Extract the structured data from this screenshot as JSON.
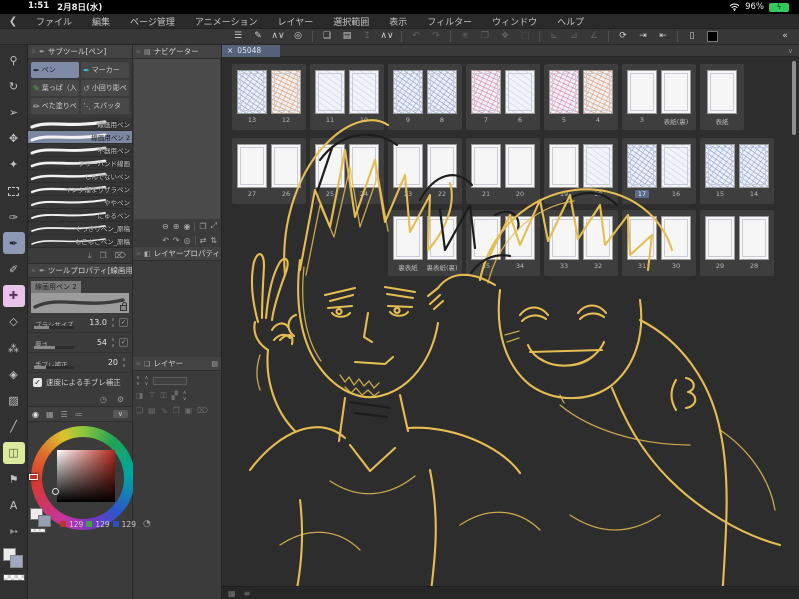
{
  "status_bar": {
    "time": "1:51",
    "date": "2月8日(水)",
    "battery_percent": "96%",
    "wifi_icon": "wifi-icon",
    "battery_icon": "battery-charging-icon",
    "bolt_glyph": "ϟ"
  },
  "menu_bar": {
    "logo_icon": "clip-studio-logo",
    "logo_glyph": "❮",
    "items": [
      "ファイル",
      "編集",
      "ページ管理",
      "アニメーション",
      "レイヤー",
      "選択範囲",
      "表示",
      "フィルター",
      "ウィンドウ",
      "ヘルプ"
    ]
  },
  "toolbar": {
    "items": [
      {
        "name": "main-menu-icon",
        "g": "☰",
        "on": true
      },
      {
        "name": "pen-settings-icon",
        "g": "✎",
        "on": true
      },
      {
        "name": "workspace-cycle-icon",
        "g": "∧∨",
        "on": true
      },
      {
        "name": "timelapse-record-icon",
        "g": "◎",
        "on": true
      },
      {
        "sep": true
      },
      {
        "name": "new-page-icon",
        "g": "❏",
        "on": true
      },
      {
        "name": "open-file-icon",
        "g": "▤",
        "on": true
      },
      {
        "name": "export-icon",
        "g": "↥",
        "on": false
      },
      {
        "name": "page-cycle-icon",
        "g": "∧∨",
        "on": true
      },
      {
        "sep": true
      },
      {
        "name": "undo-icon",
        "g": "↶",
        "on": false
      },
      {
        "name": "redo-icon",
        "g": "↷",
        "on": false
      },
      {
        "sep": true
      },
      {
        "name": "deselect-icon",
        "g": "✳",
        "on": false
      },
      {
        "name": "copy-icon",
        "g": "❐",
        "on": false
      },
      {
        "name": "paste-icon",
        "g": "❖",
        "on": false
      },
      {
        "name": "crop-icon",
        "g": "⬚",
        "on": false
      },
      {
        "sep": true
      },
      {
        "name": "snap-ruler-icon",
        "g": "⊾",
        "on": false
      },
      {
        "name": "snap-curve-icon",
        "g": "⊿",
        "on": false
      },
      {
        "name": "snap-grid-icon",
        "g": "∠",
        "on": false
      },
      {
        "sep": true
      },
      {
        "name": "view-reset-icon",
        "g": "⟳",
        "on": true
      },
      {
        "name": "next-page-icon",
        "g": "⇥",
        "on": true
      },
      {
        "name": "prev-page-icon",
        "g": "⇤",
        "on": true
      },
      {
        "sep": true
      },
      {
        "name": "companion-device-icon",
        "g": "▯",
        "on": true
      },
      {
        "name": "main-color-swatch",
        "swatch": "#000000",
        "on": true
      },
      {
        "name": "collapse-toolbar-icon",
        "g": "«",
        "on": true,
        "last": true
      }
    ]
  },
  "tool_strip": {
    "tools": [
      {
        "name": "zoom-tool",
        "g": "⚲"
      },
      {
        "name": "rotate-canvas-tool",
        "g": "↻"
      },
      {
        "name": "object-tool",
        "g": "➢"
      },
      {
        "name": "move-layer-tool",
        "g": "✥"
      },
      {
        "name": "auto-select-tool",
        "g": "✦"
      },
      {
        "name": "marquee-select-tool",
        "type": "marquee"
      },
      {
        "name": "eyedropper-tool",
        "g": "✑"
      },
      {
        "name": "pen-tool",
        "g": "✒",
        "sel": true
      },
      {
        "name": "pencil-tool",
        "g": "✐"
      },
      {
        "name": "decoration-tool",
        "g": "✚",
        "tint": "#e9c3e8",
        "fg": "#5d3a5c"
      },
      {
        "name": "eraser-tool",
        "g": "◇"
      },
      {
        "name": "blend-tool",
        "g": "⁂"
      },
      {
        "name": "fill-tool",
        "g": "◈"
      },
      {
        "name": "gradient-tool",
        "g": "▨"
      },
      {
        "name": "figure-tool",
        "g": "╱"
      },
      {
        "name": "frame-border-tool",
        "g": "◫",
        "tint": "#dcea9e",
        "fg": "#4d5a2c"
      },
      {
        "name": "polyline-tool",
        "g": "⚑"
      },
      {
        "name": "text-tool",
        "g": "A"
      },
      {
        "name": "operation-flow-tool",
        "g": "➳"
      }
    ],
    "fg_color": "#ebebeb",
    "bg_color": "#9fa9c2"
  },
  "subtool": {
    "title": "サブツール[ペン]",
    "groups": [
      {
        "label": "ペン",
        "icon": "pen-group-icon",
        "g": "✒",
        "sel": true
      },
      {
        "label": "マーカー",
        "icon": "marker-group-icon",
        "g": "✒",
        "ic": "#3fc3da"
      },
      {
        "label": "葉っぱ（入",
        "icon": "leaf-pen-icon",
        "g": "✎",
        "ic": "#55b14d"
      },
      {
        "label": "小回り彫ペ",
        "icon": "small-turn-pen-icon",
        "g": "↺",
        "ic": "#a8a8a8"
      },
      {
        "label": "べた塗りペ",
        "icon": "flat-fill-pen-icon",
        "g": "✏",
        "ic": "#c9c9c9"
      },
      {
        "label": "スパッタ",
        "icon": "spatter-icon",
        "g": "⋱",
        "ic": "#c9c9c9"
      }
    ],
    "brushes": [
      {
        "label": "線画用ペン"
      },
      {
        "label": "線画用ペン 2",
        "sel": true
      },
      {
        "label": "不器用ペン"
      },
      {
        "label": "フリーハンド線画"
      },
      {
        "label": "しんでないペン"
      },
      {
        "label": "インク溜まりザラペン"
      },
      {
        "label": "ややペン"
      },
      {
        "label": "にゅるペン"
      },
      {
        "label": "くっきりペン_原稿"
      },
      {
        "label": "もこもこペン_原稿"
      }
    ],
    "footer_icons": [
      {
        "name": "import-subtool-icon",
        "g": "⤓"
      },
      {
        "name": "duplicate-subtool-icon",
        "g": "❐"
      },
      {
        "name": "delete-subtool-icon",
        "g": "⌦"
      }
    ]
  },
  "tool_property": {
    "title": "ツールプロパティ[線画用ペ",
    "preset": "線画用ペン 2",
    "props": [
      {
        "label": "ブラシサイズ",
        "value": "13.0",
        "bar": 0.38,
        "btn": true
      },
      {
        "label": "厚さ",
        "value": "54",
        "bar": 0.52,
        "btn": true
      },
      {
        "label": "手ブレ補正",
        "value": "20",
        "bar": 0.3,
        "btn": false
      }
    ],
    "checkbox_label": "速度による手ブレ補正",
    "check_glyph": "✓",
    "stepper_glyph_up": "∧",
    "stepper_glyph_down": "∨",
    "footer_icons": [
      {
        "name": "stroke-history-icon",
        "g": "◷"
      },
      {
        "name": "wrench-icon",
        "g": "⚙"
      }
    ]
  },
  "color_panel": {
    "tabs": [
      {
        "name": "color-wheel-tab",
        "g": "◉",
        "sel": true
      },
      {
        "name": "color-set-tab",
        "g": "▦"
      },
      {
        "name": "color-slider-tab",
        "g": "☰"
      },
      {
        "name": "color-history-tab",
        "g": "≔"
      }
    ],
    "collapse_glyph": "∨",
    "rgb": [
      {
        "name": "red-value-chip",
        "color": "#b8372c",
        "value": "129"
      },
      {
        "name": "green-value-chip",
        "color": "#3da04b",
        "value": "129"
      },
      {
        "name": "blue-value-chip",
        "color": "#2f4ec0",
        "value": "129"
      }
    ],
    "extra_icon_glyph": "◔"
  },
  "navigator": {
    "title": "ナビゲーター",
    "buttons_row1": [
      {
        "name": "zoom-out-icon",
        "g": "⊖"
      },
      {
        "name": "zoom-in-icon",
        "g": "⊕"
      },
      {
        "name": "zoom-reset-icon",
        "g": "◉"
      },
      {
        "sep": true
      },
      {
        "name": "fit-screen-icon",
        "g": "❐"
      },
      {
        "name": "fit-window-icon",
        "g": "⤢"
      }
    ],
    "buttons_row2": [
      {
        "name": "rotate-left-icon",
        "g": "↶"
      },
      {
        "name": "rotate-right-icon",
        "g": "↷"
      },
      {
        "name": "rotate-reset-icon",
        "g": "◎"
      },
      {
        "sep": true
      },
      {
        "name": "flip-horizontal-icon",
        "g": "⇄"
      },
      {
        "name": "flip-vertical-icon",
        "g": "⇅"
      }
    ]
  },
  "layer_property": {
    "title": "レイヤープロパティ",
    "header_glyph": "◧",
    "side_glyph": "▤"
  },
  "layer_panel": {
    "title": "レイヤー",
    "header_glyph": "❏",
    "side_glyph": "▤",
    "row1": [
      {
        "name": "blend-mode-stepper",
        "g": "∧∨"
      },
      {
        "name": "opacity-stepper",
        "g": "∧∨"
      },
      {
        "name": "opacity-field",
        "type": "field"
      }
    ],
    "row2": [
      {
        "name": "clip-below-icon",
        "g": "◨"
      },
      {
        "name": "lock-alpha-icon",
        "g": "⊤"
      },
      {
        "name": "lock-layer-icon",
        "g": "⚿"
      },
      {
        "name": "reference-layer-icon",
        "g": "▞"
      },
      {
        "name": "palette-stepper-icon",
        "g": "∧∨",
        "sel": true
      }
    ],
    "row3": [
      {
        "name": "new-layer-icon",
        "g": "❏"
      },
      {
        "name": "new-folder-icon",
        "g": "▤"
      },
      {
        "name": "transfer-down-icon",
        "g": "⇘"
      },
      {
        "name": "merge-down-icon",
        "g": "❐"
      },
      {
        "name": "layer-mask-icon",
        "g": "▣"
      },
      {
        "name": "delete-layer-icon",
        "g": "⌦"
      }
    ]
  },
  "canvas": {
    "tab_close_glyph": "×",
    "tab_label": "05048",
    "collapse_glyph": "∨",
    "sketch_color": "#e6bd52",
    "sketch_dark": "#1d1d1d",
    "bottom_icons": [
      {
        "name": "canvas-grid-icon",
        "g": "▦"
      },
      {
        "name": "canvas-menu-icon",
        "g": "≡"
      }
    ],
    "page_rows": [
      {
        "offset": 0,
        "cards": [
          {
            "pages": [
              {
                "label": "13",
                "tint": "blue"
              },
              {
                "label": "12",
                "tint": "orange"
              }
            ]
          },
          {
            "pages": [
              {
                "label": "11",
                "tint": "faint"
              },
              {
                "label": "10",
                "tint": "faint"
              }
            ]
          },
          {
            "pages": [
              {
                "label": "9",
                "tint": "blue"
              },
              {
                "label": "8",
                "tint": "blue"
              }
            ]
          },
          {
            "pages": [
              {
                "label": "7",
                "tint": "pink"
              },
              {
                "label": "6",
                "tint": "faint"
              }
            ]
          },
          {
            "pages": [
              {
                "label": "5",
                "tint": "pink"
              },
              {
                "label": "4",
                "tint": "orange"
              }
            ]
          },
          {
            "pages": [
              {
                "label": "3",
                "tint": null
              },
              {
                "label": "表紙(裏)",
                "tint": null
              }
            ]
          },
          {
            "pages": [
              {
                "label": "表紙",
                "tint": null
              }
            ]
          }
        ]
      },
      {
        "offset": 0,
        "cards": [
          {
            "pages": [
              {
                "label": "27",
                "tint": null
              },
              {
                "label": "26",
                "tint": null
              }
            ]
          },
          {
            "pages": [
              {
                "label": "25",
                "tint": null
              },
              {
                "label": "24",
                "tint": null
              }
            ]
          },
          {
            "pages": [
              {
                "label": "23",
                "tint": null
              },
              {
                "label": "22",
                "tint": null
              }
            ]
          },
          {
            "pages": [
              {
                "label": "21",
                "tint": null
              },
              {
                "label": "20",
                "tint": null
              }
            ]
          },
          {
            "pages": [
              {
                "label": "19",
                "tint": null
              },
              {
                "label": "18",
                "tint": "faint"
              }
            ]
          },
          {
            "pages": [
              {
                "label": "17",
                "tint": "blue",
                "selected": true
              },
              {
                "label": "16",
                "tint": "faint"
              }
            ]
          },
          {
            "pages": [
              {
                "label": "15",
                "tint": "blue"
              },
              {
                "label": "14",
                "tint": "blue"
              }
            ]
          }
        ]
      },
      {
        "offset": 2,
        "cards": [
          {
            "pages": [
              {
                "label": "裏表紙",
                "tint": null
              },
              {
                "label": "裏表紙(裏)",
                "tint": null
              }
            ]
          },
          {
            "pages": [
              {
                "label": "35",
                "tint": null
              },
              {
                "label": "34",
                "tint": null
              }
            ]
          },
          {
            "pages": [
              {
                "label": "33",
                "tint": null
              },
              {
                "label": "32",
                "tint": null
              }
            ]
          },
          {
            "pages": [
              {
                "label": "31",
                "tint": null
              },
              {
                "label": "30",
                "tint": null
              }
            ]
          },
          {
            "pages": [
              {
                "label": "29",
                "tint": null
              },
              {
                "label": "28",
                "tint": null
              }
            ]
          }
        ]
      }
    ]
  }
}
